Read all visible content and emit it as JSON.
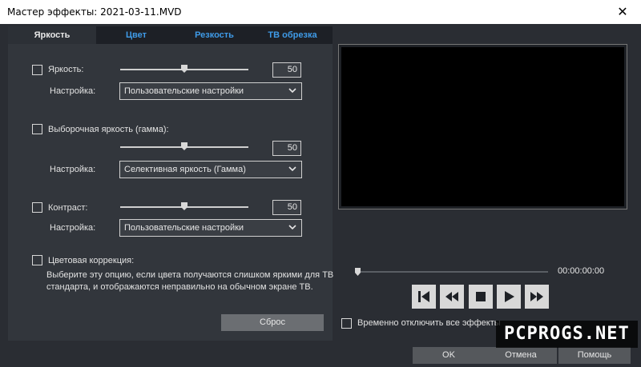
{
  "window": {
    "title": "Мастер эффекты: 2021-03-11.MVD",
    "close_glyph": "✕"
  },
  "tabs": [
    {
      "label": "Яркость",
      "active": true
    },
    {
      "label": "Цвет",
      "active": false
    },
    {
      "label": "Резкость",
      "active": false
    },
    {
      "label": "ТВ обрезка",
      "active": false
    }
  ],
  "brightness": {
    "checkbox_label": "Яркость:",
    "checked": false,
    "slider_value": 50,
    "value": "50",
    "preset_label": "Настройка:",
    "preset_value": "Пользовательские настройки"
  },
  "gamma": {
    "checkbox_label": "Выборочная яркость (гамма):",
    "checked": false,
    "slider_value": 50,
    "value": "50",
    "preset_label": "Настройка:",
    "preset_value": "Селективная яркость (Гамма)"
  },
  "contrast": {
    "checkbox_label": "Контраст:",
    "checked": false,
    "slider_value": 50,
    "value": "50",
    "preset_label": "Настройка:",
    "preset_value": "Пользовательские настройки"
  },
  "color_correction": {
    "checkbox_label": "Цветовая коррекция:",
    "checked": false,
    "description_line1": "Выберите эту опцию, если цвета получаются слишком яркими для ТВ",
    "description_line2": "стандарта, и отображаются неправильно на обычном экране ТВ."
  },
  "reset_label": "Сброс",
  "player": {
    "timecode": "00:00:00:00",
    "position": 0,
    "buttons": [
      "skip-to-start-icon",
      "rewind-icon",
      "stop-icon",
      "play-icon",
      "fast-forward-icon"
    ]
  },
  "disable_effects": {
    "label": "Временно отключить все эффекты",
    "checked": false
  },
  "dialog_buttons": {
    "ok": "OK",
    "cancel": "Отмена",
    "help": "Помощь"
  },
  "watermark": "PCPROGS.NET",
  "colors": {
    "background": "#2a2d33",
    "panel": "#32363c",
    "tab_inactive_text": "#3f9be8",
    "preview_screen": "#000000"
  }
}
